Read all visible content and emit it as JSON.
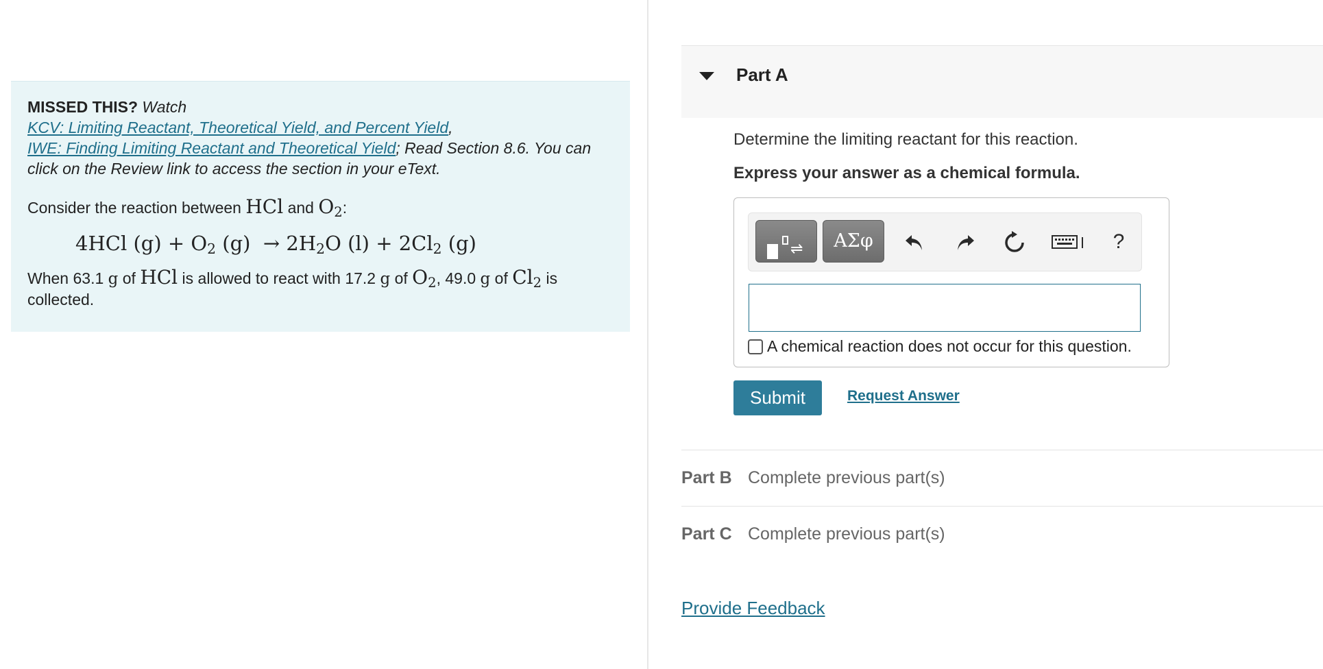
{
  "hint": {
    "missed_label": "MISSED THIS?",
    "watch_label": "Watch",
    "link1": "KCV: Limiting Reactant, Theoretical Yield, and Percent Yield",
    "sep1": ",",
    "link2": "IWE: Finding Limiting Reactant and Theoretical Yield",
    "read_text": "; Read Section 8.6. You can click on the Review link to access the section in your eText.",
    "consider_prefix": "Consider the reaction between",
    "and_text": "and",
    "colon": ":",
    "when_text": "When",
    "mass_hcl": "63.1",
    "unit_g": "g",
    "of_text": "of",
    "allowed_text": "is allowed to react with",
    "mass_o2": "17.2",
    "mass_cl2": "49.0",
    "is_text": "is",
    "collected_text": "collected."
  },
  "part_a": {
    "title": "Part A",
    "question": "Determine the limiting reactant for this reaction.",
    "instruction": "Express your answer as a chemical formula.",
    "answer_value": "",
    "greek_label": "ΑΣφ",
    "help_label": "?",
    "no_reaction_label": "A chemical reaction does not occur for this question.",
    "submit_label": "Submit",
    "request_label": "Request Answer"
  },
  "part_b": {
    "label": "Part B",
    "status": "Complete previous part(s)"
  },
  "part_c": {
    "label": "Part C",
    "status": "Complete previous part(s)"
  },
  "feedback_label": "Provide Feedback",
  "colors": {
    "link": "#1f6f8b",
    "submit": "#2e7d9a",
    "hint_bg": "#e9f5f7"
  }
}
